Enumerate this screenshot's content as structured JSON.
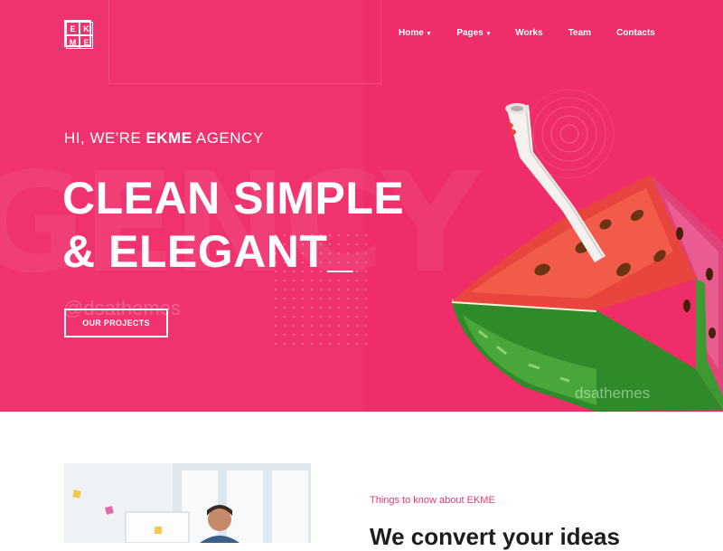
{
  "logo": {
    "letters": [
      "E",
      "K",
      "M",
      "E"
    ]
  },
  "nav": {
    "items": [
      {
        "label": "Home",
        "has_dropdown": true
      },
      {
        "label": "Pages",
        "has_dropdown": true
      },
      {
        "label": "Works",
        "has_dropdown": false
      },
      {
        "label": "Team",
        "has_dropdown": false
      },
      {
        "label": "Contacts",
        "has_dropdown": false
      }
    ]
  },
  "hero": {
    "kicker_prefix": "HI, WE'RE",
    "kicker_brand": "EKME",
    "kicker_suffix": "AGENCY",
    "headline_line1": "CLEAN SIMPLE",
    "headline_line2": "& ELEGANT_",
    "cta_label": "OUR PROJECTS",
    "ghost_word": "GENCY",
    "watermark_left": "@dsathemes",
    "watermark_right": "dsathemes"
  },
  "about": {
    "eyebrow": "Things to know about EKME",
    "title": "We convert your ideas"
  },
  "colors": {
    "brand_pink": "#f0336f",
    "accent_text": "#e83a70",
    "heading": "#1d1d1d"
  },
  "icons": {
    "caret": "chevron-down-icon"
  }
}
